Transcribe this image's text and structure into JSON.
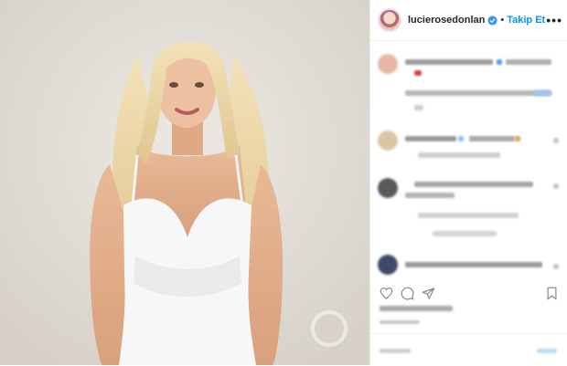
{
  "header": {
    "username": "lucierosedonlan",
    "separator": "•",
    "follow_label": "Takip Et",
    "more_label": "•••"
  },
  "icons": {
    "verified": "verified-badge-icon",
    "like": "heart-icon",
    "comment": "comment-icon",
    "share": "share-icon",
    "save": "bookmark-icon"
  },
  "colors": {
    "accent": "#0095f6",
    "text": "#262626",
    "divider": "#efefef"
  }
}
